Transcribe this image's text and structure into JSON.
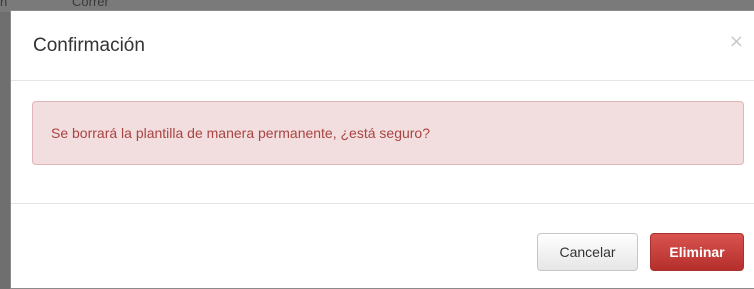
{
  "background": {
    "partial_text": "Correr",
    "edge_text": "n"
  },
  "modal": {
    "title": "Confirmación",
    "close_glyph": "×",
    "alert_message": "Se borrará la plantilla de manera permanente, ¿está seguro?",
    "buttons": {
      "cancel_label": "Cancelar",
      "delete_label": "Eliminar"
    }
  },
  "colors": {
    "alert_background": "#f2dede",
    "alert_text": "#a94442",
    "danger_button": "#c9302c"
  },
  "icons": {
    "close": "close-icon"
  }
}
